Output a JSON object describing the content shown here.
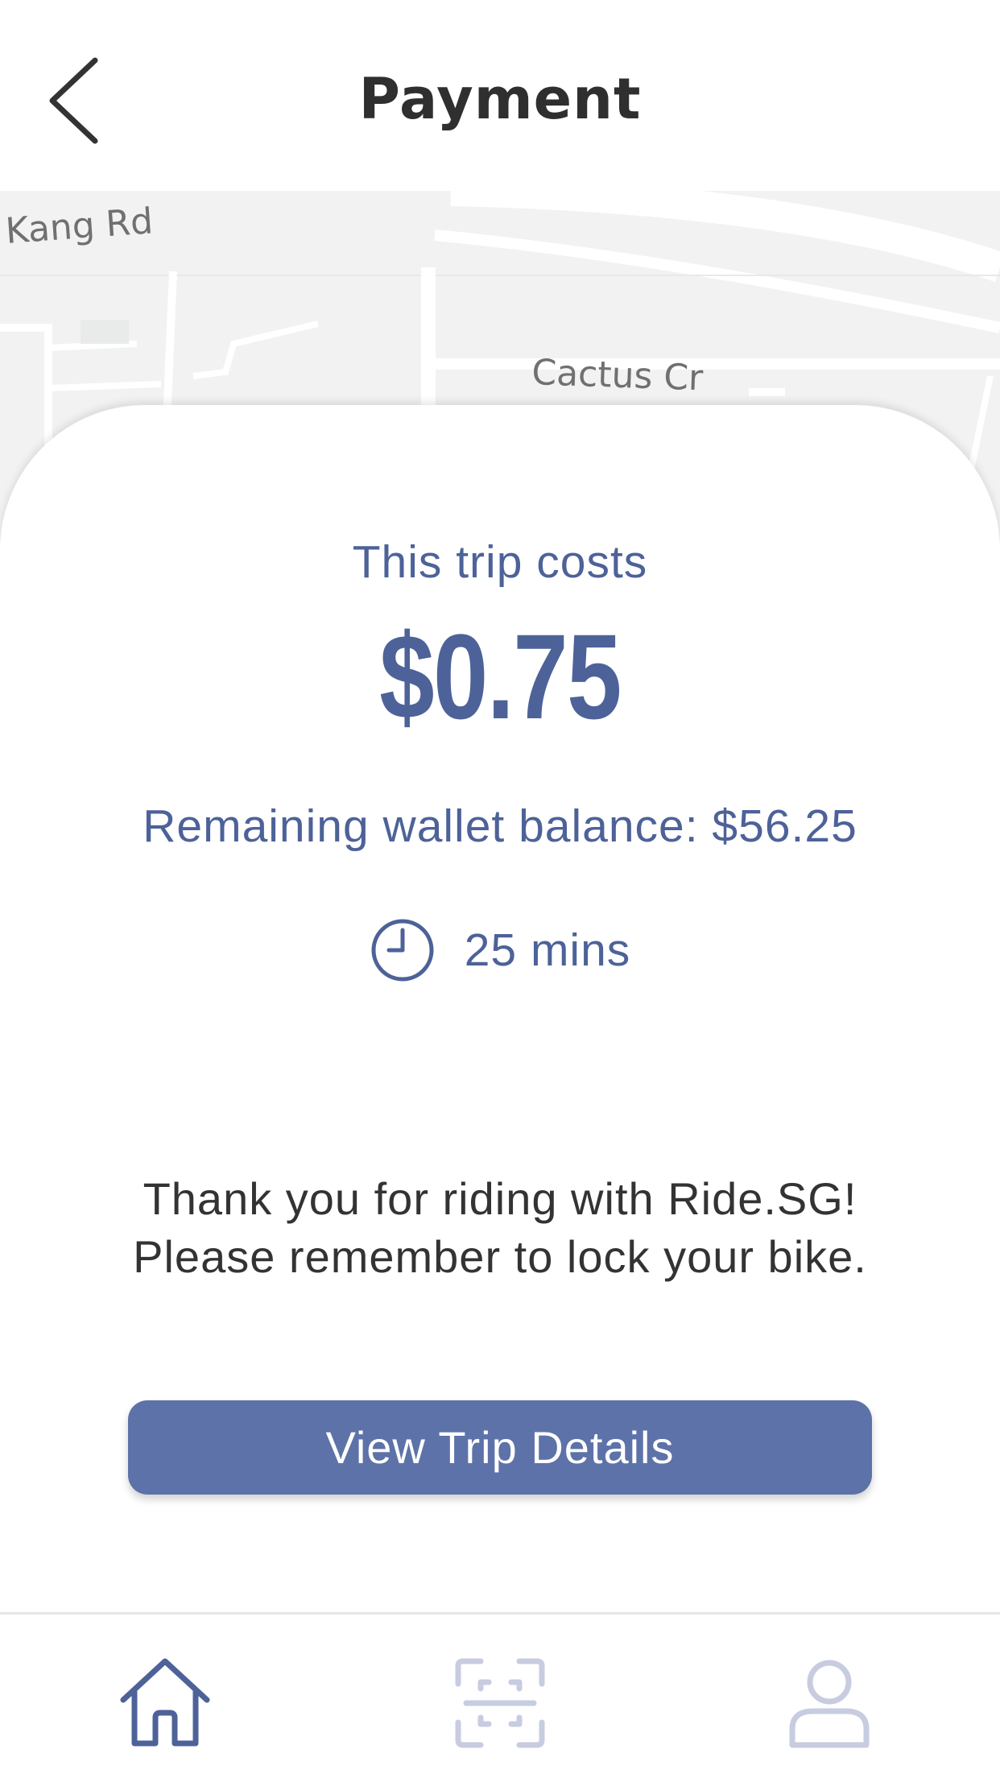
{
  "header": {
    "title": "Payment",
    "back_icon": "chevron-left-icon"
  },
  "map": {
    "labels": [
      "Kang Rd",
      "Cactus Cr"
    ]
  },
  "summary": {
    "cost_label": "This trip costs",
    "cost_amount": "$0.75",
    "wallet_balance": "Remaining wallet balance: $56.25",
    "duration_icon": "clock-icon",
    "duration": "25 mins"
  },
  "message": {
    "line1": "Thank you for riding with Ride.SG!",
    "line2": "Please remember to lock your bike."
  },
  "actions": {
    "view_trip_details": "View Trip Details"
  },
  "tabbar": {
    "items": [
      {
        "icon": "home-icon",
        "active": true
      },
      {
        "icon": "scan-icon",
        "active": false
      },
      {
        "icon": "profile-icon",
        "active": false
      }
    ]
  },
  "colors": {
    "accent": "#4d6298",
    "button": "#5d72a8",
    "tab_inactive": "#c7cce0"
  }
}
